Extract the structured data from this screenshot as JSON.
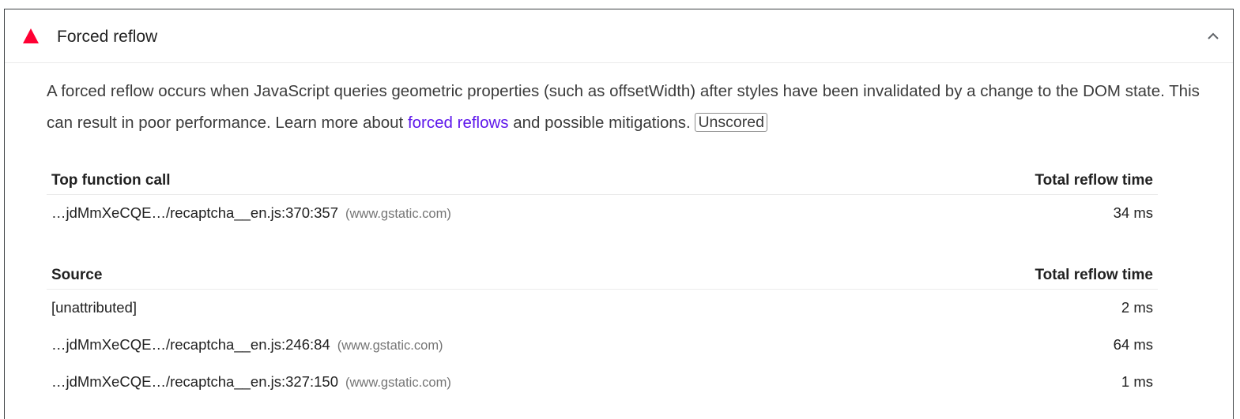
{
  "audit": {
    "title": "Forced reflow",
    "status_icon": "warning-triangle-icon",
    "toggle_icon": "chevron-up-icon",
    "colors": {
      "fail": "#ff0033",
      "link": "#5e17eb"
    },
    "description": {
      "text_before_link": "A forced reflow occurs when JavaScript queries geometric properties (such as offsetWidth) after styles have been invalidated by a change to the DOM state. This can result in poor performance. Learn more about ",
      "link_text": "forced reflows",
      "text_after_link": " and possible mitigations.",
      "badge": "Unscored"
    }
  },
  "table_top": {
    "headers": {
      "left": "Top function call",
      "right": "Total reflow time"
    },
    "rows": [
      {
        "source": "…jdMmXeCQE…/recaptcha__en.js:370:357",
        "host": "(www.gstatic.com)",
        "time": "34 ms"
      }
    ]
  },
  "table_source": {
    "headers": {
      "left": "Source",
      "right": "Total reflow time"
    },
    "rows": [
      {
        "source": "[unattributed]",
        "host": "",
        "time": "2 ms"
      },
      {
        "source": "…jdMmXeCQE…/recaptcha__en.js:246:84",
        "host": "(www.gstatic.com)",
        "time": "64 ms"
      },
      {
        "source": "…jdMmXeCQE…/recaptcha__en.js:327:150",
        "host": "(www.gstatic.com)",
        "time": "1 ms"
      }
    ]
  }
}
